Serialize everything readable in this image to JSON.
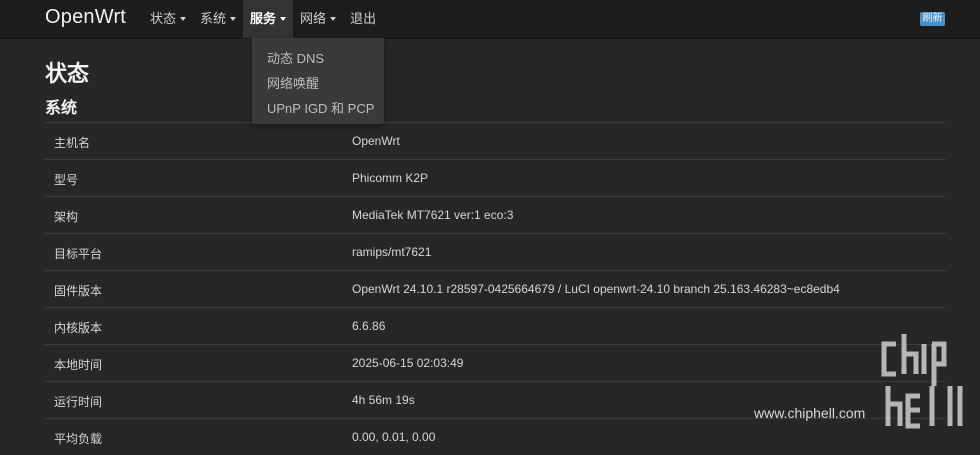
{
  "header": {
    "brand": "OpenWrt",
    "menu": [
      {
        "label": "状态",
        "caret": true
      },
      {
        "label": "系统",
        "caret": true
      },
      {
        "label": "服务",
        "caret": true,
        "active": true
      },
      {
        "label": "网络",
        "caret": true
      },
      {
        "label": "退出",
        "caret": false
      }
    ],
    "refresh_label": "刷新",
    "accent_color": "#4a91c9"
  },
  "dropdown": {
    "items": [
      "动态 DNS",
      "网络唤醒",
      "UPnP IGD 和 PCP"
    ]
  },
  "page": {
    "title": "状态",
    "section_title": "系统"
  },
  "system_table": [
    {
      "key": "主机名",
      "value": "OpenWrt"
    },
    {
      "key": "型号",
      "value": "Phicomm K2P"
    },
    {
      "key": "架构",
      "value": "MediaTek MT7621 ver:1 eco:3"
    },
    {
      "key": "目标平台",
      "value": "ramips/mt7621"
    },
    {
      "key": "固件版本",
      "value": "OpenWrt 24.10.1 r28597-0425664679 / LuCI openwrt-24.10 branch 25.163.46283~ec8edb4"
    },
    {
      "key": "内核版本",
      "value": "6.6.86"
    },
    {
      "key": "本地时间",
      "value": "2025-06-15 02:03:49"
    },
    {
      "key": "运行时间",
      "value": "4h 56m 19s"
    },
    {
      "key": "平均负载",
      "value": "0.00, 0.01, 0.00"
    }
  ],
  "watermark": {
    "url": "www.chiphell.com",
    "logo_text": "chiphell"
  }
}
